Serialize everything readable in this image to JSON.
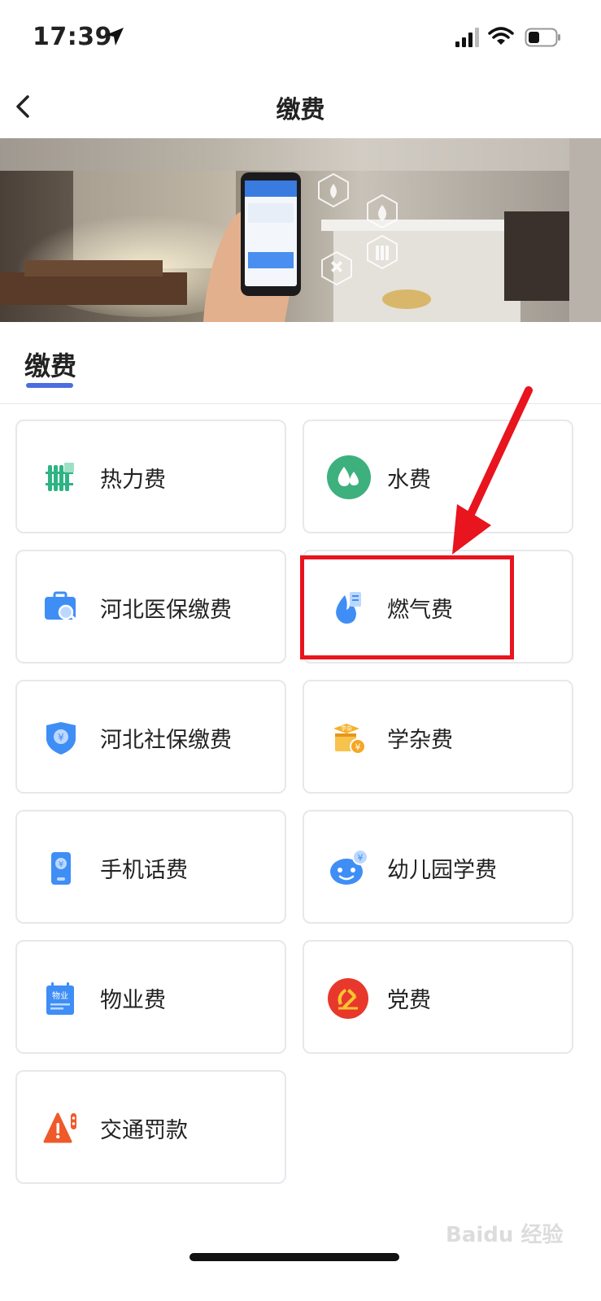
{
  "status": {
    "time": "17:39"
  },
  "nav": {
    "title": "缴费"
  },
  "section": {
    "title": "缴费"
  },
  "services": [
    {
      "label": "热力费",
      "icon": "radiator-icon"
    },
    {
      "label": "水费",
      "icon": "water-drop-icon"
    },
    {
      "label": "河北医保缴费",
      "icon": "medical-insurance-icon"
    },
    {
      "label": "燃气费",
      "icon": "gas-flame-icon"
    },
    {
      "label": "河北社保缴费",
      "icon": "social-security-shield-icon"
    },
    {
      "label": "学杂费",
      "icon": "tuition-box-icon"
    },
    {
      "label": "手机话费",
      "icon": "mobile-phone-icon"
    },
    {
      "label": "幼儿园学费",
      "icon": "kindergarten-face-icon"
    },
    {
      "label": "物业费",
      "icon": "property-notebook-icon"
    },
    {
      "label": "党费",
      "icon": "party-emblem-icon"
    },
    {
      "label": "交通罚款",
      "icon": "traffic-warning-icon"
    }
  ],
  "icon_texts": {
    "tuition": "学杂",
    "property": "物业"
  },
  "watermark": "Baidu 经验",
  "colors": {
    "accent": "#4a6ee0",
    "highlight": "#e8141e"
  }
}
